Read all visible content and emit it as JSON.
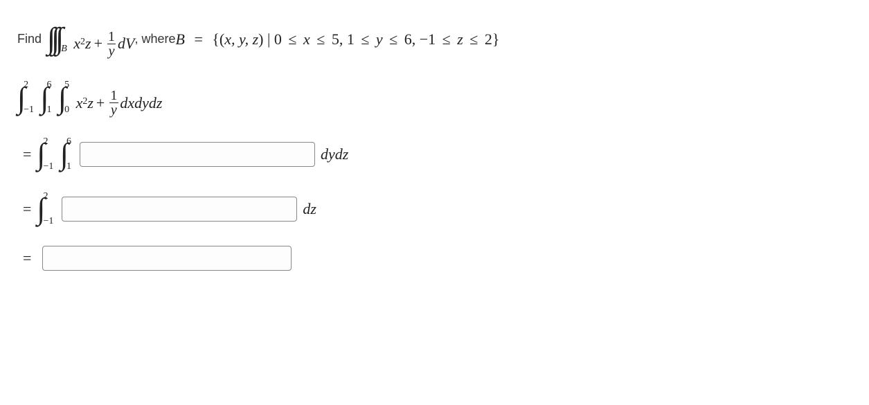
{
  "problem": {
    "find_text": "Find",
    "where_text": ", where ",
    "region_var": "B",
    "region_eq": "=",
    "region_set_open": "{(",
    "region_vars": "x, y, z",
    "region_set_mid": ") | ",
    "constraint_x_low": "0",
    "constraint_x_var": "x",
    "constraint_x_high": "5",
    "constraint_y_low": "1",
    "constraint_y_var": "y",
    "constraint_y_high": "6",
    "constraint_z_low": "−1",
    "constraint_z_var": "z",
    "constraint_z_high": "2",
    "region_set_close": "}",
    "leq": "≤",
    "comma": ", ",
    "integrand_x": "x",
    "integrand_x_pow": "2",
    "integrand_z": "z",
    "plus": "+",
    "frac_num": "1",
    "frac_den": "y",
    "dV": "dV",
    "sub_B": "B"
  },
  "step2": {
    "int1_lower": "−1",
    "int1_upper": "2",
    "int2_lower": "1",
    "int2_upper": "6",
    "int3_lower": "0",
    "int3_upper": "5",
    "integrand_x": "x",
    "integrand_x_pow": "2",
    "integrand_z": "z",
    "plus": "+",
    "frac_num": "1",
    "frac_den": "y",
    "diff": "dxdydz"
  },
  "step3": {
    "int1_lower": "−1",
    "int1_upper": "2",
    "int2_lower": "1",
    "int2_upper": "6",
    "diff": "dydz"
  },
  "step4": {
    "int1_lower": "−1",
    "int1_upper": "2",
    "diff": "dz"
  }
}
